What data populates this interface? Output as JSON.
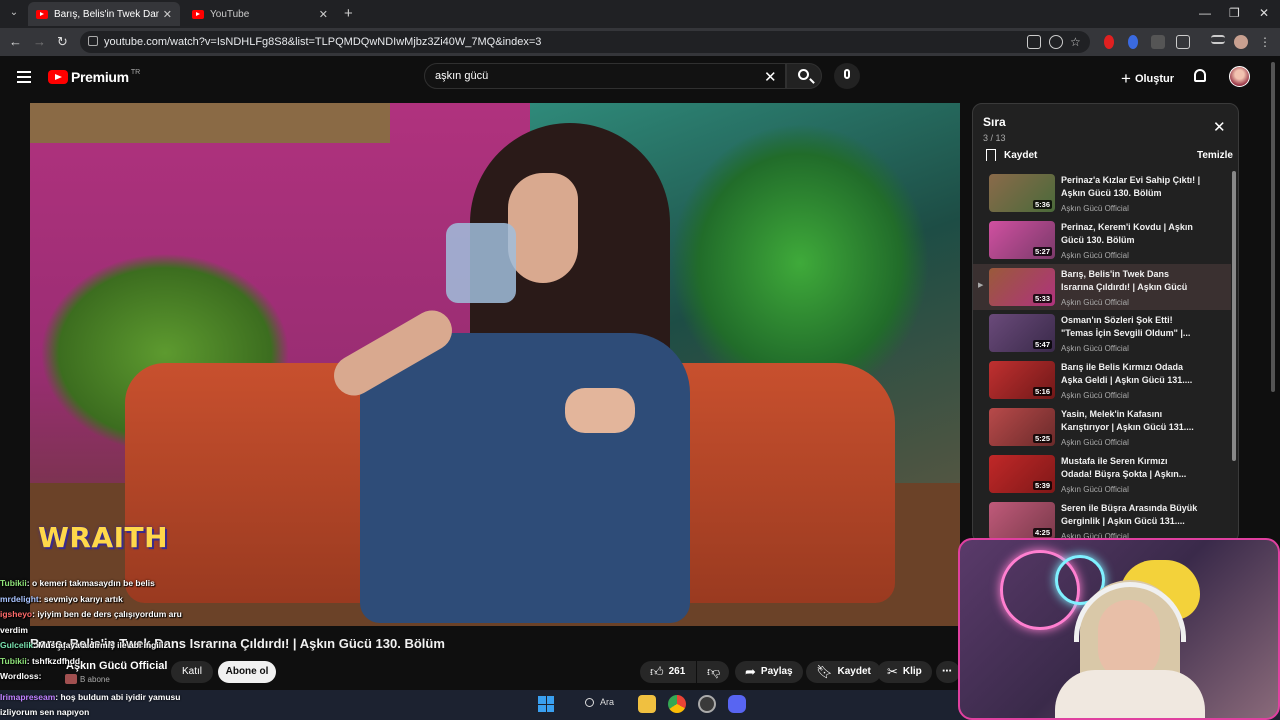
{
  "browser": {
    "tabs": [
      {
        "label": "Barış, Belis'in Twek Dans Israrına Çıldırdı! | Aşkın Gücü 130. Bölüm",
        "active": true
      },
      {
        "label": "YouTube",
        "active": false
      }
    ],
    "url": "youtube.com/watch?v=IsNDHLFg8S8&list=TLPQMDQwNDIwMjbz3Zi40W_7MQ&index=3"
  },
  "header": {
    "logo_text": "Premium",
    "logo_badge": "TR",
    "search_value": "aşkın gücü",
    "create_label": "Oluştur"
  },
  "video": {
    "overlay_brand": "WRAITH",
    "title": "Barış, Belis'in Twek Dans Israrına Çıldırdı! | Aşkın Gücü 130. Bölüm",
    "channel": "Aşkın Gücü Official",
    "subscribers": "B abone",
    "join_label": "Katıl",
    "subscribe_label": "Abone ol",
    "likes": "261",
    "share_label": "Paylaş",
    "save_label": "Kaydet",
    "clip_label": "Klip"
  },
  "queue": {
    "title": "Sıra",
    "position": "3 / 13",
    "save_label": "Kaydet",
    "clear_label": "Temizle",
    "items": [
      {
        "title": "Perinaz'a Kızlar Evi Sahip Çıktı! | Aşkın Gücü 130. Bölüm",
        "channel": "Aşkın Gücü Official",
        "duration": "5:36",
        "current": false,
        "color": "#7a5a3a"
      },
      {
        "title": "Perinaz, Kerem'i Kovdu | Aşkın Gücü 130. Bölüm",
        "channel": "Aşkın Gücü Official",
        "duration": "5:27",
        "current": false,
        "color": "#c04a9a"
      },
      {
        "title": "Barış, Belis'in Twek Dans Israrına Çıldırdı! | Aşkın Gücü 130. Bölüm",
        "channel": "Aşkın Gücü Official",
        "duration": "5:33",
        "current": true,
        "color": "#8a4a3a"
      },
      {
        "title": "Osman'ın Sözleri Şok Etti! \"Temas İçin Sevgili Oldum\" |...",
        "channel": "Aşkın Gücü Official",
        "duration": "5:47",
        "current": false,
        "color": "#6a4a6a"
      },
      {
        "title": "Barış ile Belis Kırmızı Odada Aşka Geldi | Aşkın Gücü 131....",
        "channel": "Aşkın Gücü Official",
        "duration": "5:16",
        "current": false,
        "color": "#b03030"
      },
      {
        "title": "Yasin, Melek'in Kafasını Karıştırıyor | Aşkın Gücü 131....",
        "channel": "Aşkın Gücü Official",
        "duration": "5:25",
        "current": false,
        "color": "#a84040"
      },
      {
        "title": "Mustafa ile Seren Kırmızı Odada! Büşra Şokta | Aşkın...",
        "channel": "Aşkın Gücü Official",
        "duration": "5:39",
        "current": false,
        "color": "#b02828"
      },
      {
        "title": "Seren ile Büşra Arasında Büyük Gerginlik | Aşkın Gücü 131....",
        "channel": "Aşkın Gücü Official",
        "duration": "4:25",
        "current": false,
        "color": "#b04a6a"
      }
    ]
  },
  "chat": {
    "messages": [
      {
        "user": "Tubikii",
        "text": ": o kemeri takmasaydın be belis",
        "color": "#8fe37a"
      },
      {
        "user": "mrdelight",
        "text": ": sevmiyo karıyı artık",
        "color": "#a9c4ff"
      },
      {
        "user": "igsheyo",
        "text": ": iyiyim ben de ders çalışıyordum aru",
        "color": "#ff6a6a"
      },
      {
        "user": "",
        "text": "verdim",
        "color": "#ffffff"
      },
      {
        "user": "Gulcelik",
        "text": ": Mustafaya aldırmış ile abi ingiliz",
        "color": "#7ae3b0"
      },
      {
        "user": "Tubikii",
        "text": ": tshfkzdfhdd",
        "color": "#8fe37a"
      },
      {
        "user": "Wordloss",
        "text": ":",
        "color": "#ffffff"
      }
    ],
    "bottom": [
      {
        "user": "Irimapreseam",
        "text": ": hoş buldum abi iyidir yamusu",
        "color": "#c080ff"
      },
      {
        "user": "",
        "text": "izliyorum sen napıyon",
        "color": "#ffffff"
      }
    ]
  },
  "taskbar": {
    "search_label": "Ara"
  },
  "colors": {
    "yt_red": "#ff0000",
    "background": "#0f0f0f",
    "webcam_border": "#e040a0"
  }
}
